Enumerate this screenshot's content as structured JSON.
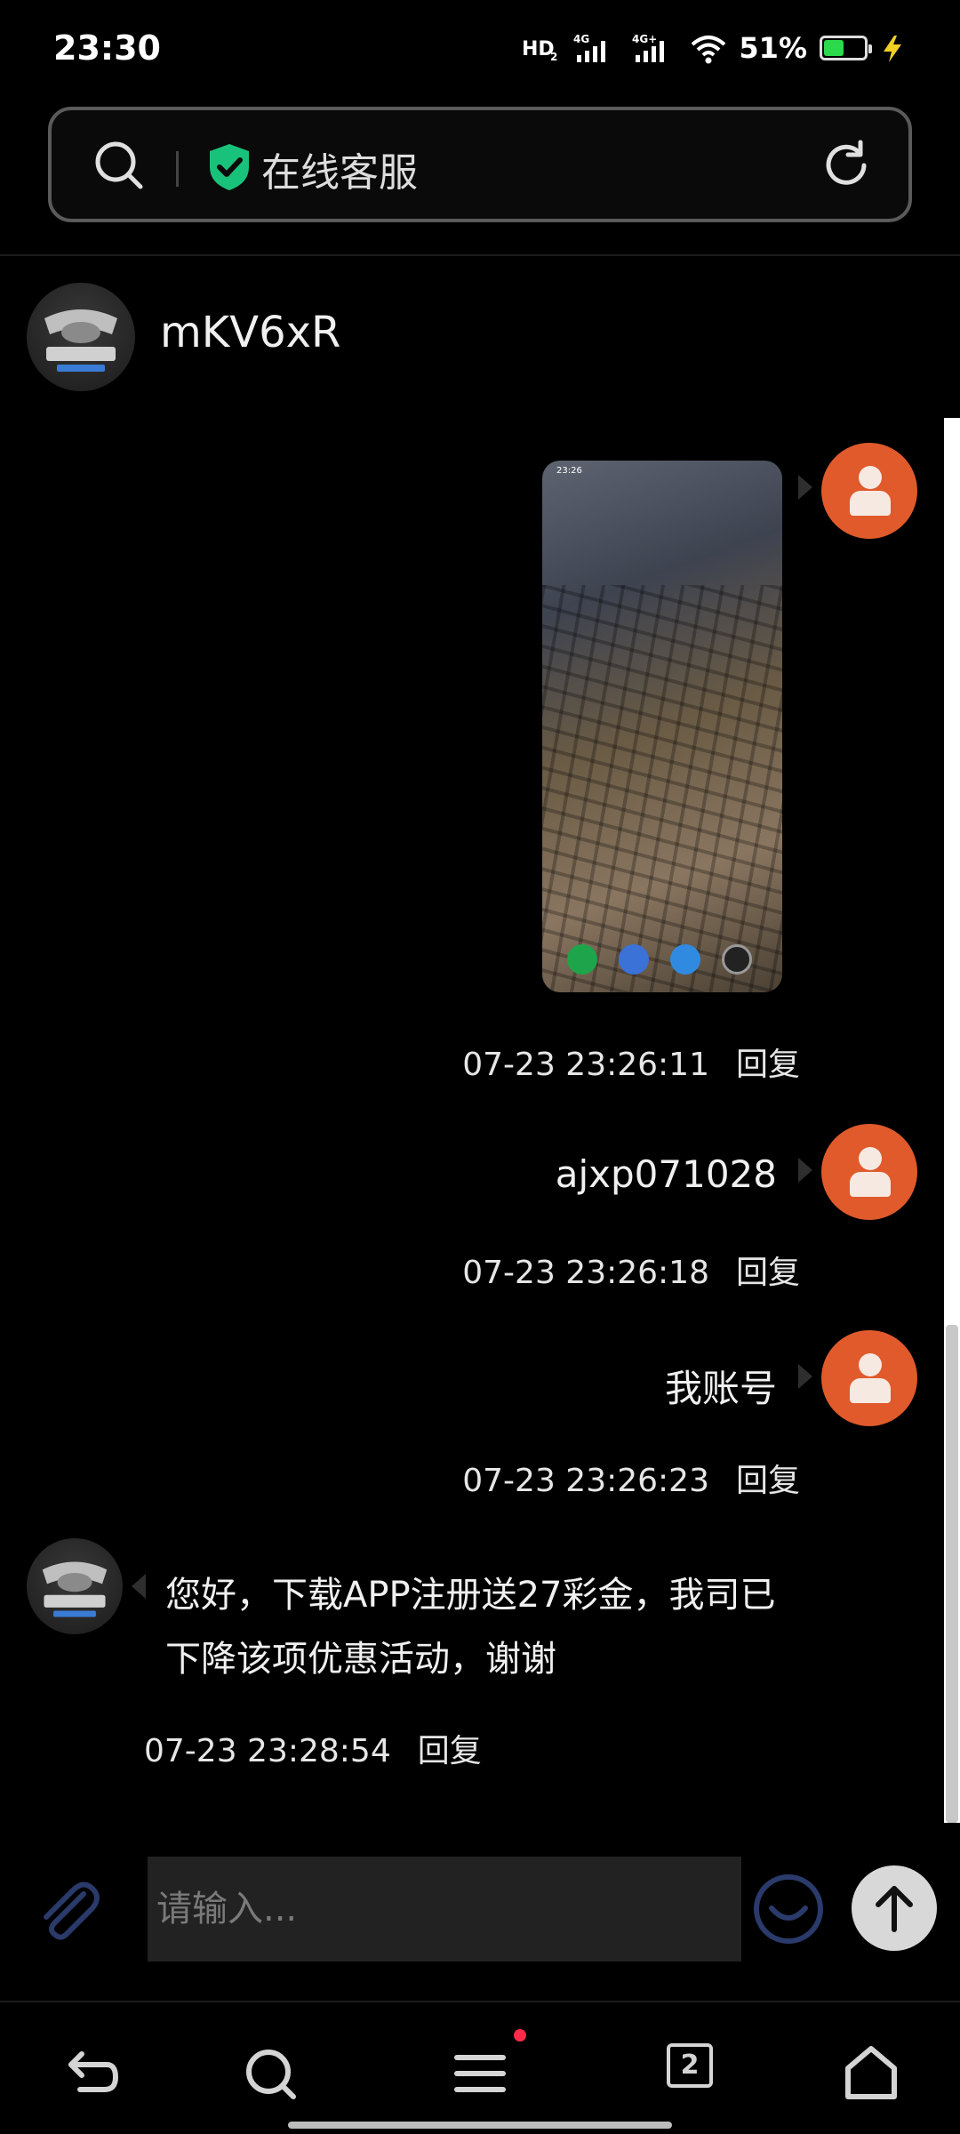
{
  "status_bar": {
    "time": "23:30",
    "signal_labels": [
      "HD2",
      "4G",
      "4G+"
    ],
    "battery_percent": "51%",
    "battery_level": 0.51,
    "battery_color": "#2bd94a"
  },
  "address_bar": {
    "title": "在线客服",
    "shield_color": "#19c27a"
  },
  "chat": {
    "peer_name": "mKV6xR",
    "messages": [
      {
        "from": "user",
        "type": "image",
        "time": "07-23 23:26:11",
        "reply": "回复",
        "image_time": "23:26"
      },
      {
        "from": "user",
        "type": "text",
        "text": "ajxp071028",
        "time": "07-23 23:26:18",
        "reply": "回复"
      },
      {
        "from": "user",
        "type": "text",
        "text": "我账号",
        "time": "07-23 23:26:23",
        "reply": "回复"
      },
      {
        "from": "agent",
        "type": "text",
        "text": "您好，下载APP注册送27彩金，我司已下降该项优惠活动，谢谢",
        "time": "07-23 23:28:54",
        "reply": "回复"
      }
    ],
    "user_avatar_color": "#e05a2b"
  },
  "input": {
    "placeholder": "请输入..."
  },
  "bottom_nav": {
    "tab_count": "2",
    "items": [
      "back-icon",
      "search-icon",
      "menu-icon",
      "tabs-icon",
      "home-icon"
    ]
  }
}
